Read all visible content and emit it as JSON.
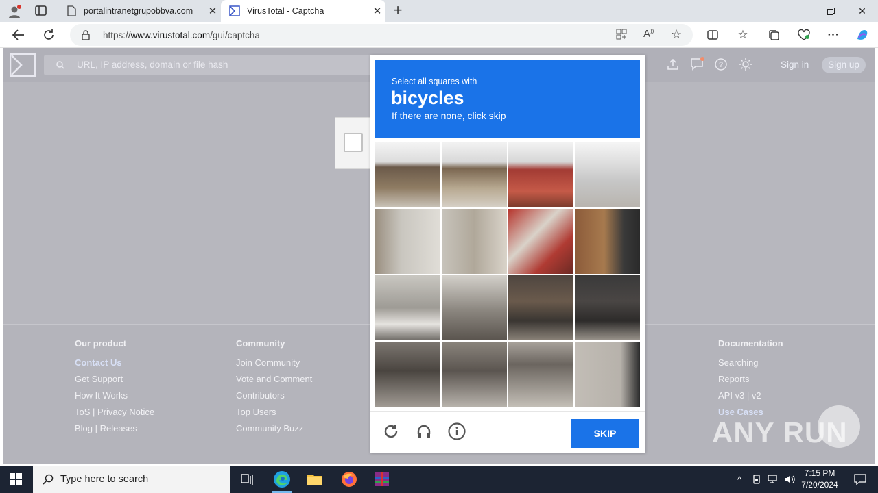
{
  "browser": {
    "tabs": [
      {
        "title": "portalintranetgrupobbva.com",
        "active": false
      },
      {
        "title": "VirusTotal - Captcha",
        "active": true
      }
    ],
    "url_prefix": "https://",
    "url_domain": "www.virustotal.com",
    "url_path": "/gui/captcha"
  },
  "page": {
    "search_placeholder": "URL, IP address, domain or file hash",
    "sign_in": "Sign in",
    "sign_up": "Sign up",
    "footer": {
      "our_product": {
        "heading": "Our product",
        "items": [
          "Contact Us",
          "Get Support",
          "How It Works",
          "ToS | Privacy Notice",
          "Blog | Releases"
        ]
      },
      "community": {
        "heading": "Community",
        "items": [
          "Join Community",
          "Vote and Comment",
          "Contributors",
          "Top Users",
          "Community Buzz"
        ]
      },
      "documentation": {
        "heading": "Documentation",
        "items": [
          "Searching",
          "Reports",
          "API v3 | v2",
          "Use Cases"
        ]
      }
    }
  },
  "captcha": {
    "line1": "Select all squares with",
    "target": "bicycles",
    "line3": "If there are none, click skip",
    "skip_label": "SKIP"
  },
  "watermark": "ANY RUN",
  "taskbar": {
    "search_placeholder": "Type here to search",
    "time": "7:15 PM",
    "date": "7/20/2024"
  },
  "colors": {
    "accent": "#1a73e8",
    "overlay": "#b7b7be",
    "taskbar": "#1c2433"
  }
}
